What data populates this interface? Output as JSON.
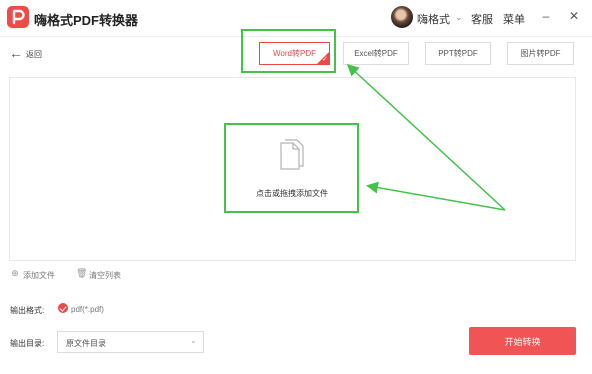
{
  "app": {
    "title": "嗨格式PDF转换器"
  },
  "header": {
    "username": "嗨格式",
    "links": [
      "客服",
      "菜单"
    ]
  },
  "toolbar": {
    "back_label": "返回",
    "tabs": [
      "Word转PDF",
      "Excel转PDF",
      "PPT转PDF",
      "图片转PDF"
    ],
    "active_tab": "Word转PDF"
  },
  "drop_zone": {
    "label": "点击或拖拽添加文件"
  },
  "actions": {
    "add_file": "添加文件",
    "clear_list": "清空列表"
  },
  "output": {
    "format_label": "输出格式:",
    "format_value": "pdf(*.pdf)",
    "dir_label": "输出目录:",
    "dir_value": "原文件目录"
  },
  "start_button": "开始转换",
  "colors": {
    "accent": "#f05454",
    "annotation": "#44c24a"
  }
}
